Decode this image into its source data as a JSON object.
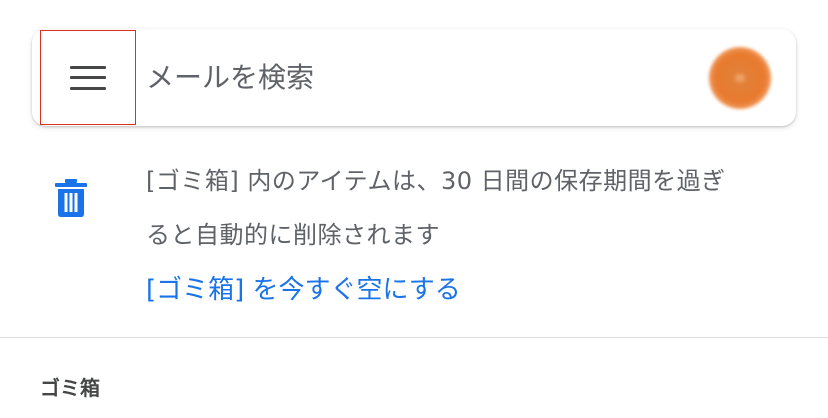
{
  "search": {
    "placeholder": "メールを検索"
  },
  "trash_notice": {
    "line1": "[ゴミ箱] 内のアイテムは、30 日間の保存期間を過ぎ",
    "line2": "ると自動的に削除されます",
    "link_label": "[ゴミ箱] を今すぐ空にする"
  },
  "section": {
    "label": "ゴミ箱"
  },
  "icons": {
    "menu": "hamburger-menu-icon",
    "trash": "trash-icon",
    "avatar": "account-avatar"
  },
  "colors": {
    "accent": "#1a73e8",
    "highlight_box": "#d93025",
    "avatar": "#e87a2e",
    "text_secondary": "#5f6368"
  }
}
